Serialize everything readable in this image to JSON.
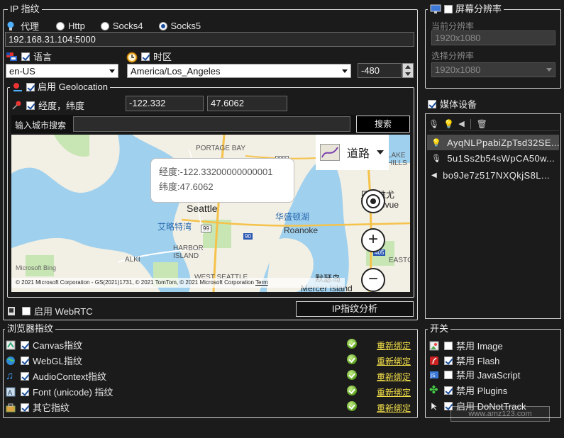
{
  "ip_fingerprint": {
    "legend": "IP 指纹",
    "proxy_label": "代理",
    "proxy_options": [
      "Http",
      "Socks4",
      "Socks5"
    ],
    "proxy_selected": "Socks5",
    "proxy_address": "192.168.31.104:5000",
    "language_label": "语言",
    "language_value": "en-US",
    "timezone_label": "时区",
    "timezone_value": "America/Los_Angeles",
    "timezone_offset": "-480",
    "geolocation_label": "启用 Geolocation",
    "lnglat_label": "经度，纬度",
    "longitude": "-122.332",
    "latitude": "47.6062",
    "city_search_label": "输入城市搜索",
    "city_search_value": "",
    "search_button": "搜索",
    "map": {
      "tooltip_lng": "经度:-122.33200000000001",
      "tooltip_lat": "纬度:47.6062",
      "style_label": "道路",
      "labels": [
        "PORTAGE BAY",
        "Seattle",
        "艾略特湾",
        "华盛顿湖",
        "Roanoke",
        "HARBOR ISLAND",
        "ALKI",
        "WEST SEATTLE",
        "贝尔维尤",
        "Bellevue",
        "默瑟岛",
        "Mercer Island",
        "EASTGA",
        "LAKE HILLS",
        "99",
        "90",
        "520",
        "405",
        "5"
      ],
      "brand": "Microsoft Bing",
      "copyright": "© 2021 Microsoft Corporation - GS(2021)1731, © 2021 TomTom, © 2021 Microsoft Corporation",
      "terms": "Term"
    },
    "webrtc_label": "启用 WebRTC",
    "analyze_button": "IP指纹分析"
  },
  "resolution": {
    "legend": "屏幕分辨率",
    "current_label": "当前分辨率",
    "current_value": "1920x1080",
    "select_label": "选择分辨率",
    "select_value": "1920x1080"
  },
  "media": {
    "legend": "媒体设备",
    "items": [
      "AyqNLPpabiZpTsd32SE...",
      "5u1Ss2b54sWpCA50w...",
      "bo9Je7z517NXQkjS8L..."
    ]
  },
  "browser_fingerprint": {
    "legend": "浏览器指纹",
    "items": [
      {
        "label": "Canvas指纹",
        "action": "重新绑定"
      },
      {
        "label": "WebGL指纹",
        "action": "重新绑定"
      },
      {
        "label": "AudioContext指纹",
        "action": "重新绑定"
      },
      {
        "label": "Font (unicode) 指纹",
        "action": "重新绑定"
      },
      {
        "label": "其它指纹",
        "action": "重新绑定"
      }
    ]
  },
  "switches": {
    "legend": "开关",
    "items": [
      {
        "label": "禁用 Image",
        "checked": false
      },
      {
        "label": "禁用 Flash",
        "checked": true
      },
      {
        "label": "禁用 JavaScript",
        "checked": false
      },
      {
        "label": "禁用 Plugins",
        "checked": true
      },
      {
        "label": "启用 DoNotTrack",
        "checked": true
      }
    ]
  },
  "watermark": "www.amz123.com",
  "colors": {
    "background": "#1b1b1b",
    "link": "#f4e04a",
    "selected_item": "#4a4a4a",
    "water": "#9fd0ee",
    "land": "#f2efe4",
    "park": "#c8e6b4"
  }
}
